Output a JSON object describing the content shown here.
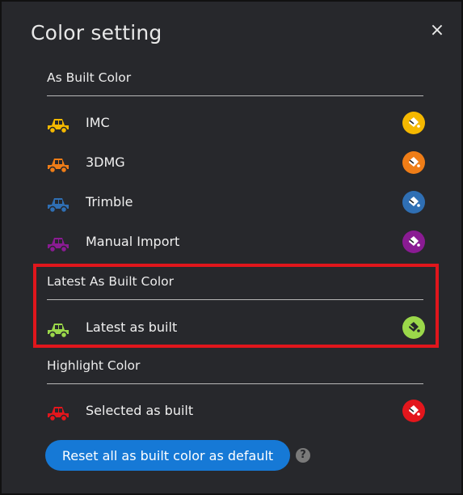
{
  "dialog": {
    "title": "Color setting",
    "close_glyph": "×"
  },
  "sections": {
    "as_built": {
      "title": "As Built Color",
      "items": [
        {
          "label": "IMC",
          "color": "#f5b800",
          "icon": "truck-icon",
          "picker_icon": "paint-bucket-icon"
        },
        {
          "label": "3DMG",
          "color": "#ef7d17",
          "icon": "truck-icon",
          "picker_icon": "paint-bucket-icon"
        },
        {
          "label": "Trimble",
          "color": "#2f6fb4",
          "icon": "truck-icon",
          "picker_icon": "paint-bucket-icon"
        },
        {
          "label": "Manual Import",
          "color": "#8a1b93",
          "icon": "truck-icon",
          "picker_icon": "paint-bucket-icon"
        }
      ]
    },
    "latest": {
      "title": "Latest As Built Color",
      "items": [
        {
          "label": "Latest as built",
          "color": "#9bd84a",
          "icon": "truck-icon",
          "picker_icon": "paint-bucket-icon"
        }
      ]
    },
    "highlight": {
      "title": "Highlight Color",
      "items": [
        {
          "label": "Selected as built",
          "color": "#e3161c",
          "icon": "truck-icon",
          "picker_icon": "paint-bucket-icon"
        }
      ]
    }
  },
  "reset_button": {
    "label": "Reset all as built color as default",
    "color": "#1679d6"
  },
  "help_icon": {
    "glyph": "?"
  },
  "annotation": {
    "color": "#e0161c"
  }
}
